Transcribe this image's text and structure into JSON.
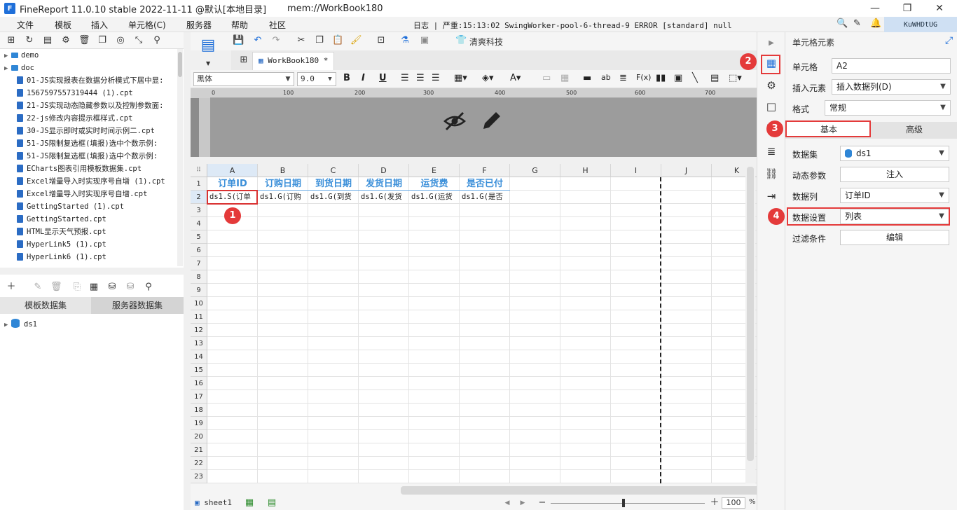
{
  "app": {
    "title": "FineReport 11.0.10 stable 2022-11-11 @默认[本地目录]",
    "path": "mem://WorkBook180",
    "window_controls": [
      "—",
      "❐",
      "✕"
    ]
  },
  "menu": {
    "items": [
      "文件",
      "模板",
      "插入",
      "单元格(C)",
      "服务器",
      "帮助",
      "社区"
    ],
    "log_text": "日志 | 严重:15:13:02 SwingWorker-pool-6-thread-9 ERROR [standard] null",
    "user": "KuWHDtUG"
  },
  "tree": {
    "folders": [
      "demo",
      "doc"
    ],
    "files": [
      "01-JS实现报表在数据分析模式下居中显:",
      "1567597557319444 (1).cpt",
      "21-JS实现动态隐藏参数以及控制参数面:",
      "22-js修改内容提示框样式.cpt",
      "30-JS显示即时或实时时间示例二.cpt",
      "51-JS限制复选框(填报)选中个数示例:",
      "51-JS限制复选框(填报)选中个数示例:",
      "ECharts图表引用模板数据集.cpt",
      "Excel增量导入时实现序号自增 (1).cpt",
      "Excel增量导入时实现序号自增.cpt",
      "GettingStarted (1).cpt",
      "GettingStarted.cpt",
      "HTML显示天气预报.cpt",
      "HyperLink5 (1).cpt",
      "HyperLink6 (1).cpt"
    ]
  },
  "datasets": {
    "tabs": [
      "模板数据集",
      "服务器数据集"
    ],
    "items": [
      "ds1"
    ]
  },
  "ribbon": {
    "brand_label": "清爽科技",
    "workbook_tab": "WorkBook180 *",
    "font_name": "黑体",
    "font_size": "9.0"
  },
  "ruler": {
    "ticks": [
      "0",
      "100",
      "200",
      "300",
      "400",
      "500",
      "600",
      "700"
    ]
  },
  "sheet": {
    "columns": [
      "A",
      "B",
      "C",
      "D",
      "E",
      "F",
      "G",
      "H",
      "I",
      "J",
      "K"
    ],
    "rows": [
      "1",
      "2",
      "3",
      "4",
      "5",
      "6",
      "7",
      "8",
      "9",
      "10",
      "11",
      "12",
      "13",
      "14",
      "15",
      "16",
      "17",
      "18",
      "19",
      "20",
      "21",
      "22",
      "23"
    ],
    "header_cells": [
      "订单ID",
      "订购日期",
      "到货日期",
      "发货日期",
      "运货费",
      "是否已付"
    ],
    "data_cells": [
      "ds1.S(订单",
      "ds1.G(订购",
      "ds1.G(到货",
      "ds1.G(发货",
      "ds1.G(运货",
      "ds1.G(是否"
    ],
    "sheet_name": "sheet1",
    "zoom": "100",
    "zoom_unit": "%"
  },
  "badges": [
    "1",
    "2",
    "3",
    "4"
  ],
  "panel": {
    "title": "单元格元素",
    "cell_label": "单元格",
    "cell_value": "A2",
    "insert_label": "插入元素",
    "insert_value": "插入数据列(D)",
    "format_label": "格式",
    "format_value": "常规",
    "tab_basic": "基本",
    "tab_advanced": "高级",
    "dataset_label": "数据集",
    "dataset_value": "ds1",
    "dyn_label": "动态参数",
    "dyn_button": "注入",
    "column_label": "数据列",
    "column_value": "订单ID",
    "setting_label": "数据设置",
    "setting_value": "列表",
    "filter_label": "过滤条件",
    "filter_button": "编辑"
  },
  "colors": {
    "accent": "#3b8fd9",
    "highlight": "#e43a3a"
  }
}
